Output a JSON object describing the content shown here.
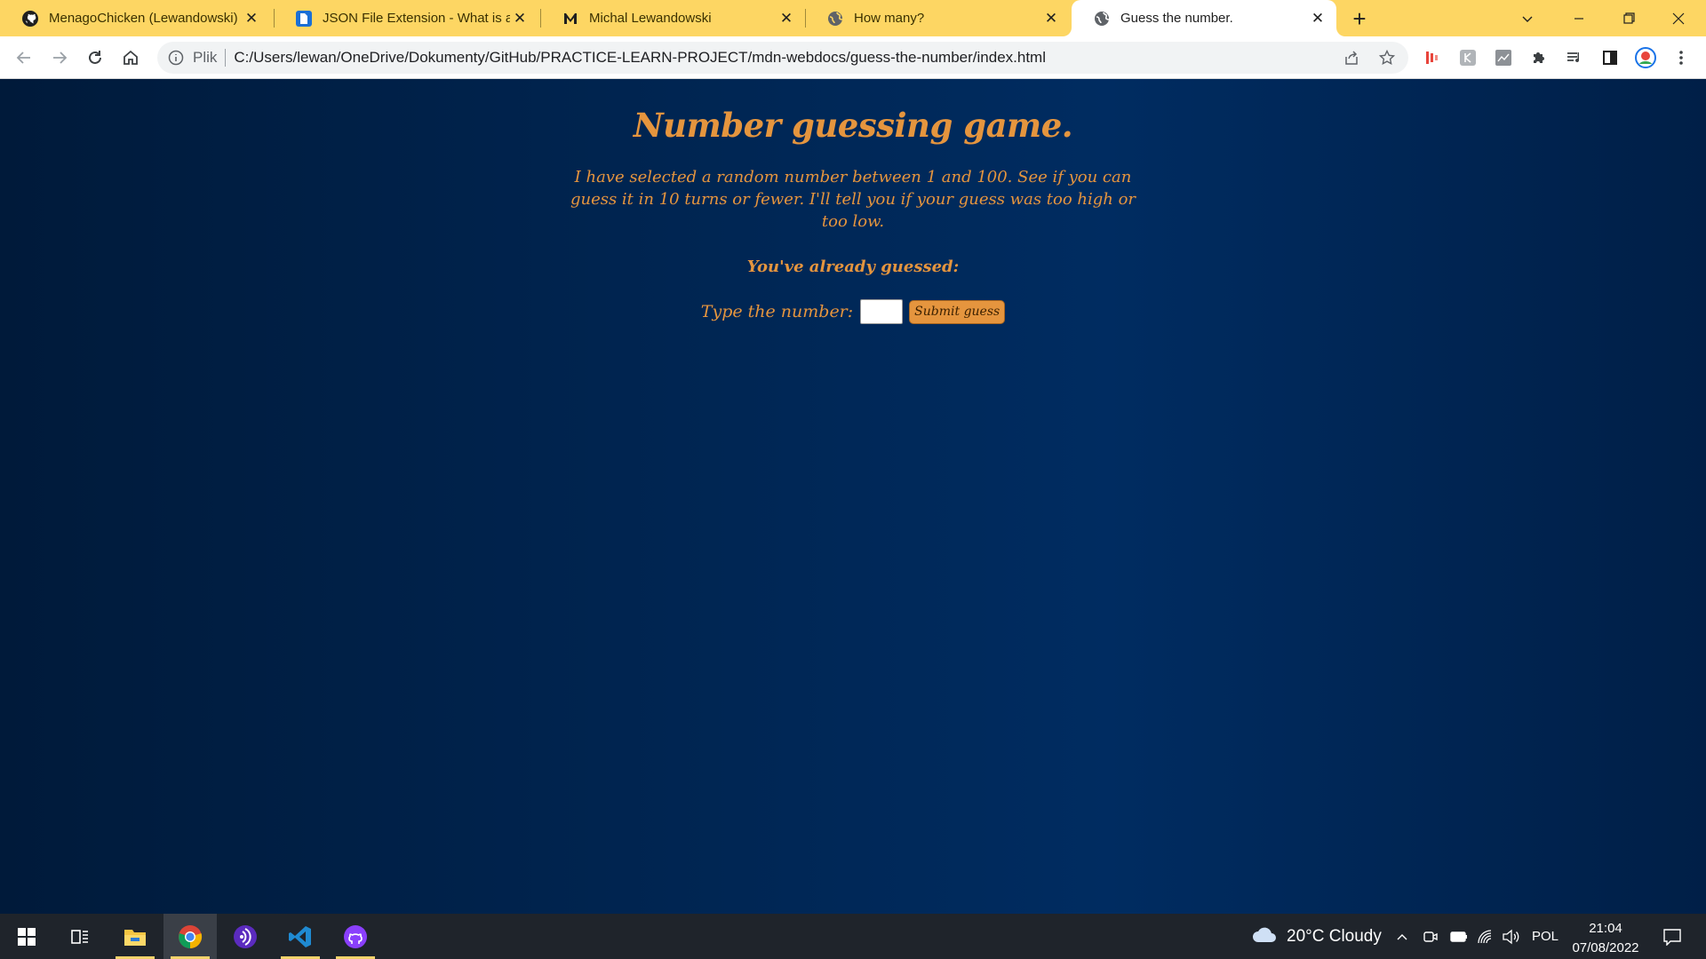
{
  "browser": {
    "tabs": [
      {
        "title": "MenagoChicken (Lewandowski)",
        "icon": "github-icon",
        "active": false
      },
      {
        "title": "JSON File Extension - What is a .json",
        "icon": "document-icon",
        "active": false
      },
      {
        "title": "Michal Lewandowski",
        "icon": "m-logo-icon",
        "active": false
      },
      {
        "title": "How many?",
        "icon": "globe-icon",
        "active": false
      },
      {
        "title": "Guess the number.",
        "icon": "globe-icon",
        "active": true
      }
    ],
    "new_tab_symbol": "+",
    "address": {
      "scheme_label": "Plik",
      "url": "C:/Users/lewan/OneDrive/Dokumenty/GitHub/PRACTICE-LEARN-PROJECT/mdn-webdocs/guess-the-number/index.html"
    }
  },
  "page": {
    "title": "Number guessing game.",
    "intro": "I have selected a random number between 1 and 100. See if you can guess it in 10 turns or fewer. I'll tell you if your guess was too high or too low.",
    "guessed_label": "You've already guessed:",
    "field_label": "Type the number:",
    "field_value": "",
    "submit_label": "Submit guess",
    "colors": {
      "accent": "#e5953e",
      "background": "#002858"
    }
  },
  "taskbar": {
    "weather": "20°C  Cloudy",
    "language": "POL",
    "time": "21:04",
    "date": "07/08/2022",
    "colors": {
      "running_indicator": "#f5d36b"
    }
  }
}
